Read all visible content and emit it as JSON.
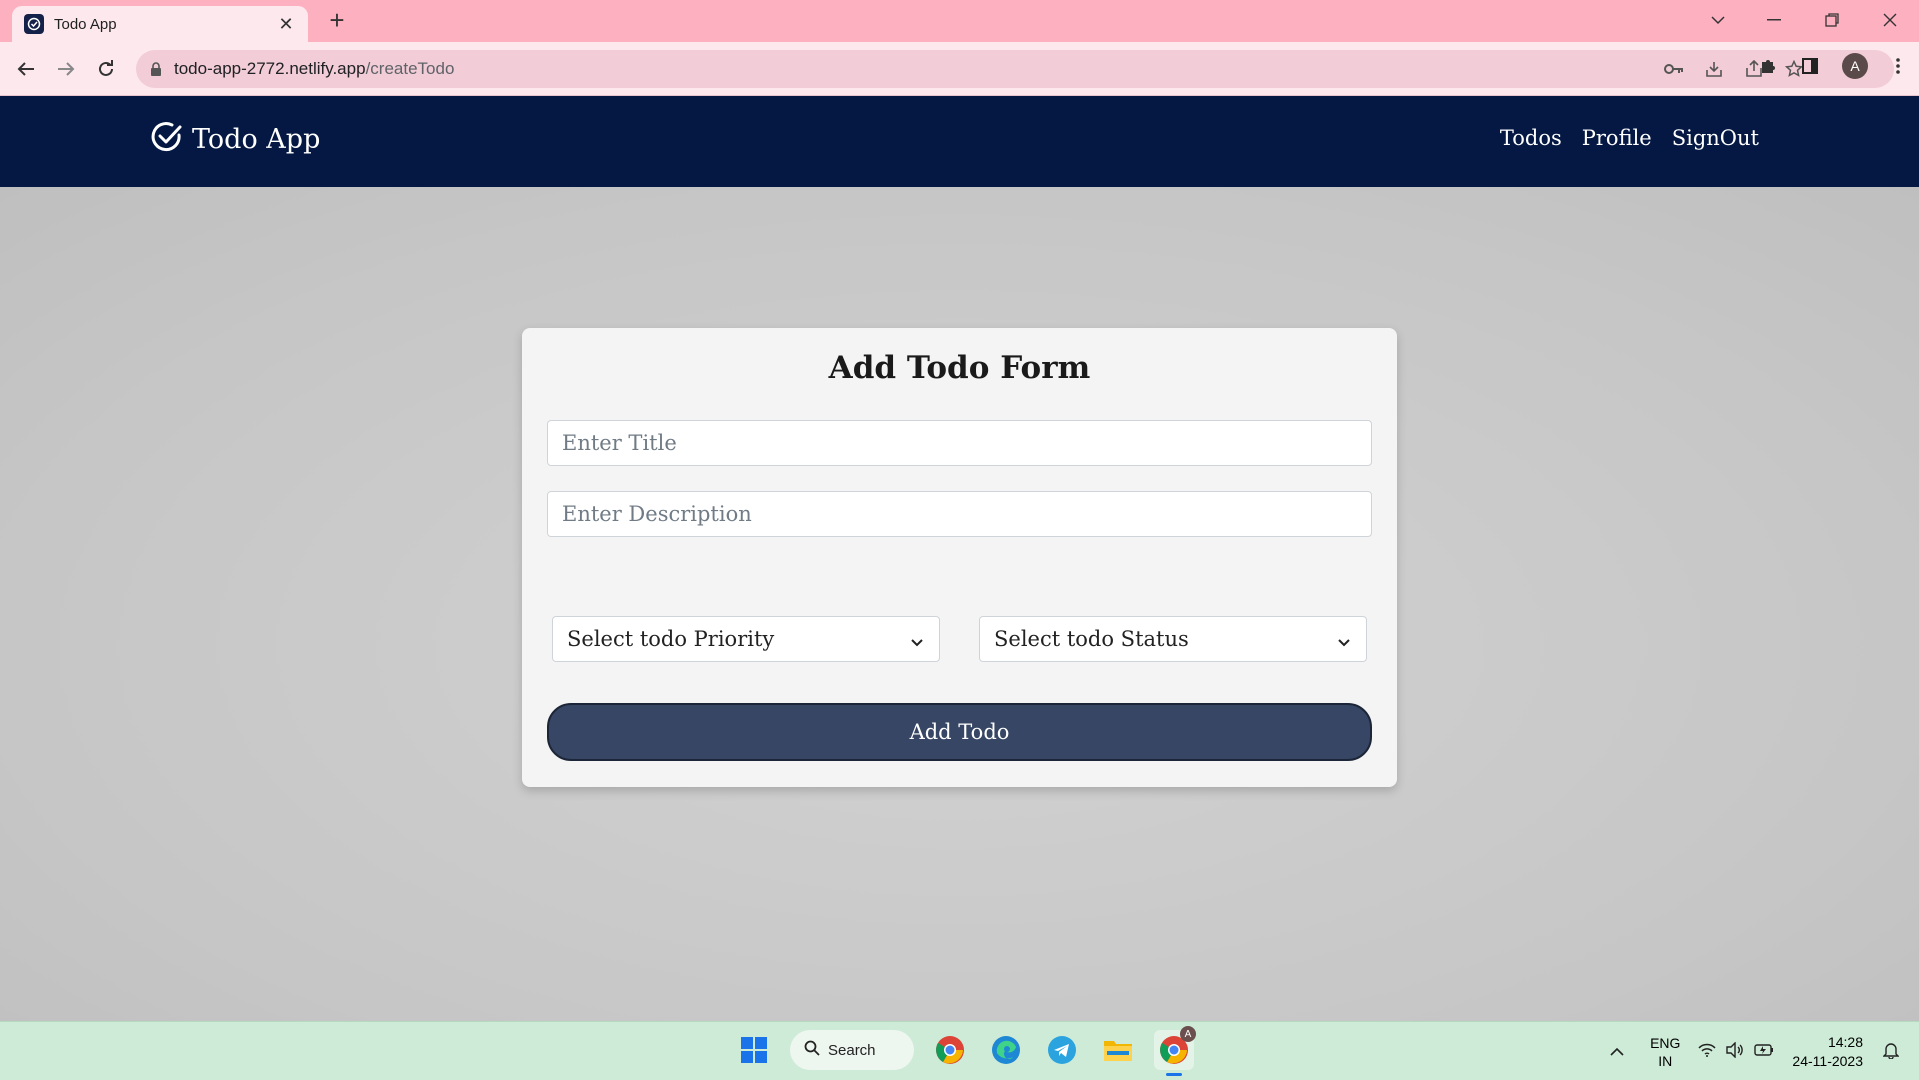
{
  "browser": {
    "tab_title": "Todo App",
    "url_host": "todo-app-2772.netlify.app",
    "url_path": "/createTodo",
    "profile_initial": "A"
  },
  "navbar": {
    "brand": "Todo App",
    "links": [
      "Todos",
      "Profile",
      "SignOut"
    ]
  },
  "form": {
    "title": "Add Todo Form",
    "title_placeholder": "Enter Title",
    "description_placeholder": "Enter Description",
    "priority_select": "Select todo Priority",
    "status_select": "Select todo Status",
    "submit_label": "Add Todo"
  },
  "taskbar": {
    "search_label": "Search",
    "lang_line1": "ENG",
    "lang_line2": "IN",
    "time": "14:28",
    "date": "24-11-2023",
    "chrome_badge": "A"
  },
  "colors": {
    "tabbar": "#fdb0c0",
    "navbar": "#041843",
    "button": "#374664",
    "taskbar": "#cdebd6"
  }
}
